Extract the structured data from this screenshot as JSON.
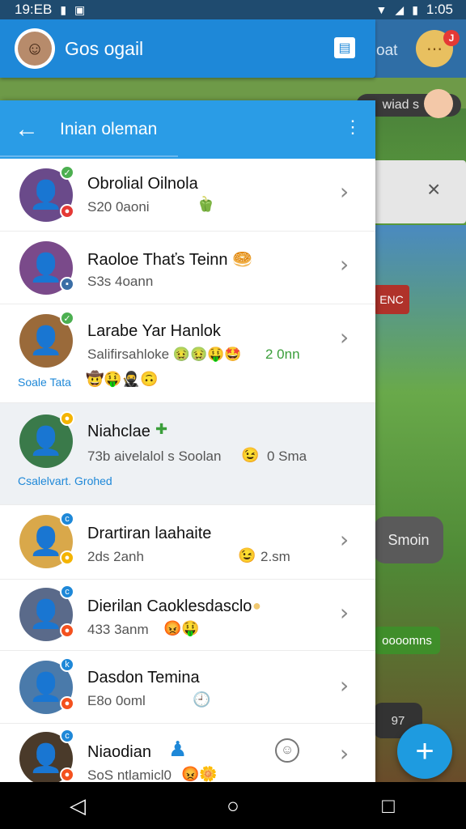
{
  "status_bar": {
    "time": "19:EB",
    "icons_left": [
      "sim-icon",
      "photo-icon"
    ],
    "clock": "1:05"
  },
  "header": {
    "title": "Gos ogail"
  },
  "background": {
    "header_partial": "oat",
    "badge": "J",
    "pill_text": "wiad s",
    "scene_tag": "ENC",
    "dark_pill": "Smoin",
    "green_pill": "oooomns",
    "dark_strip": "97"
  },
  "toolbar": {
    "title": "Inian oleman"
  },
  "contacts": [
    {
      "name": "Obrolial Oilnola",
      "sub": "S20 0aoni",
      "emoji": "🫑",
      "tag": ""
    },
    {
      "name": "Raoloe Thaťs Teinn 🥯",
      "sub": "S3s 4oann",
      "emoji": "",
      "tag": ""
    },
    {
      "name": "Larabe Yar Hanlok",
      "sub": "Salifirsahloke 🤢🤢🤑🤩",
      "time": "2 0nn",
      "emoji": "🤠🤑🥷🙃",
      "tag": "Soale Tata"
    },
    {
      "name": "Niahclae",
      "sub": "73b aivelalol s  Soolan",
      "time": "0 Sma",
      "emoji": "😉",
      "tag": "Csalelvart. Grohed"
    },
    {
      "name": "Drartiran laahaite",
      "sub": "2ds 2anh",
      "time": "2.sm",
      "emoji": "😉",
      "tag": ""
    },
    {
      "name": "Dierilan Caoklesdasclo",
      "sub": "433 3anm",
      "emoji": "😡🤑",
      "tag": ""
    },
    {
      "name": "Dasdon Temina",
      "sub": "E8o 0oml",
      "emoji": "🕘",
      "tag": ""
    },
    {
      "name": "Niaodian",
      "sub": "SoS ntlamicl0",
      "emoji": "😡🌼",
      "tag": ""
    }
  ],
  "nav": {
    "back": "◁",
    "home": "○",
    "recent": "□"
  },
  "colors": {
    "header": "#1e88d8",
    "toolbar": "#2a9ce6",
    "fab": "#1e9be0"
  }
}
